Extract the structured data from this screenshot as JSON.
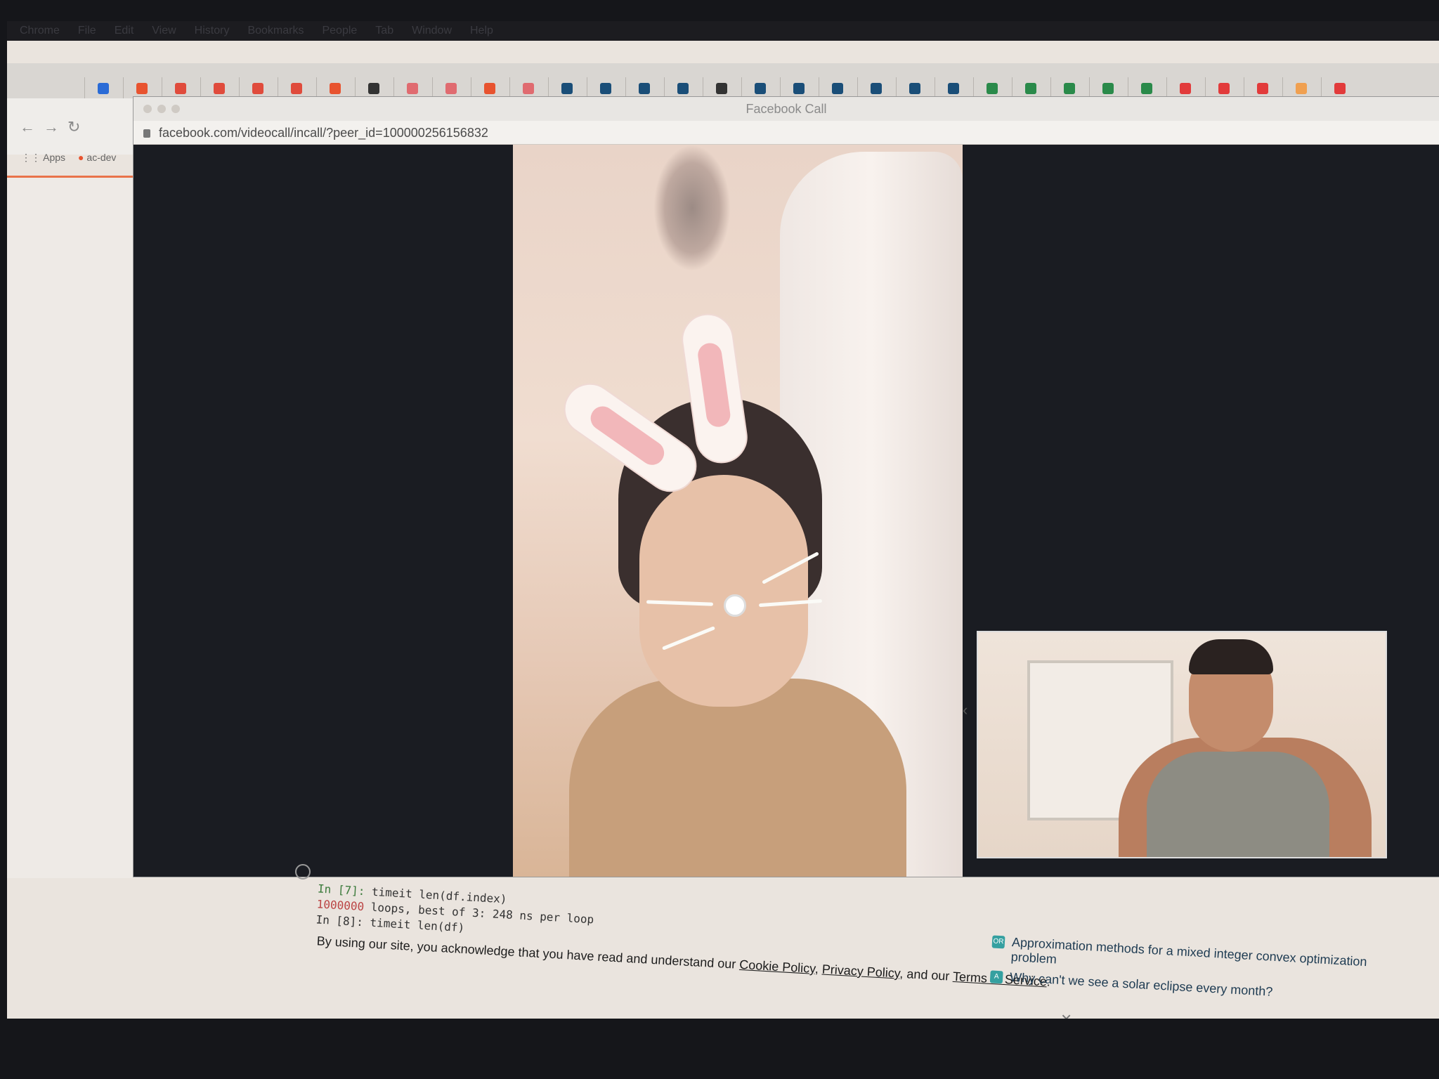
{
  "menubar": {
    "items": [
      "Chrome",
      "File",
      "Edit",
      "View",
      "History",
      "Bookmarks",
      "People",
      "Tab",
      "Window",
      "Help"
    ]
  },
  "tabs": [
    {
      "icon": "x-icon",
      "color": "#2a6bd6"
    },
    {
      "icon": "fox-icon",
      "color": "#e8532f"
    },
    {
      "icon": "gmail-icon",
      "color": "#e04b3c"
    },
    {
      "icon": "gmail-icon",
      "color": "#e04b3c"
    },
    {
      "icon": "gmail-icon",
      "color": "#e04b3c"
    },
    {
      "icon": "gmail-icon",
      "color": "#e04b3c"
    },
    {
      "icon": "fox-icon",
      "color": "#e8532f"
    },
    {
      "icon": "github-icon",
      "color": "#333333"
    },
    {
      "icon": "s-icon",
      "color": "#e06b70"
    },
    {
      "icon": "s-icon",
      "color": "#e06b70"
    },
    {
      "icon": "fox-icon",
      "color": "#e8532f"
    },
    {
      "icon": "s-icon",
      "color": "#e06b70"
    },
    {
      "icon": "x-icon",
      "color": "#1a4e78"
    },
    {
      "icon": "x-icon",
      "color": "#1a4e78"
    },
    {
      "icon": "up-icon",
      "color": "#1a4e78"
    },
    {
      "icon": "up-icon",
      "color": "#1a4e78"
    },
    {
      "icon": "github-icon",
      "color": "#333333"
    },
    {
      "icon": "up-icon",
      "color": "#1a4e78"
    },
    {
      "icon": "x-icon",
      "color": "#1a4e78"
    },
    {
      "icon": "x-icon",
      "color": "#1a4e78"
    },
    {
      "icon": "x-icon",
      "color": "#1a4e78"
    },
    {
      "icon": "x-icon",
      "color": "#1a4e78"
    },
    {
      "icon": "x-icon",
      "color": "#1a4e78"
    },
    {
      "icon": "up-icon",
      "color": "#2a8a4a"
    },
    {
      "icon": "up-icon",
      "color": "#2a8a4a"
    },
    {
      "icon": "up-icon",
      "color": "#2a8a4a"
    },
    {
      "icon": "up-icon",
      "color": "#2a8a4a"
    },
    {
      "icon": "up-icon",
      "color": "#2a8a4a"
    },
    {
      "icon": "k-icon",
      "color": "#e23b3b"
    },
    {
      "icon": "k-icon",
      "color": "#e23b3b"
    },
    {
      "icon": "k-icon",
      "color": "#e23b3b"
    },
    {
      "icon": "orange-icon",
      "color": "#f0a050"
    },
    {
      "icon": "red-icon",
      "color": "#e23b3b"
    }
  ],
  "back_browser": {
    "bookmark_apps": "Apps",
    "bookmark_acdev": "ac-dev"
  },
  "call_window": {
    "title": "Facebook Call",
    "url": "facebook.com/videocall/incall/?peer_id=100000256156832"
  },
  "notebook": {
    "line1_prompt": "In [7]:",
    "line1_code": " timeit len(df.index)",
    "line2_num": "1000000",
    "line2_text": " loops, best of 3: 248 ns per loop",
    "line3": "In [8]: timeit len(df)"
  },
  "cookie_banner": {
    "prefix": "By using our site, you acknowledge that you have read and understand our ",
    "cookie_policy": "Cookie Policy",
    "sep1": ", ",
    "privacy_policy": "Privacy Policy",
    "sep2": ", and our ",
    "terms": "Terms of Service",
    "suffix": ".",
    "close": "×"
  },
  "related_questions": [
    {
      "badge": "OR",
      "text": "Approximation methods for a mixed integer convex optimization problem"
    },
    {
      "badge": "A",
      "text": "Why can't we see a solar eclipse every month?"
    }
  ]
}
